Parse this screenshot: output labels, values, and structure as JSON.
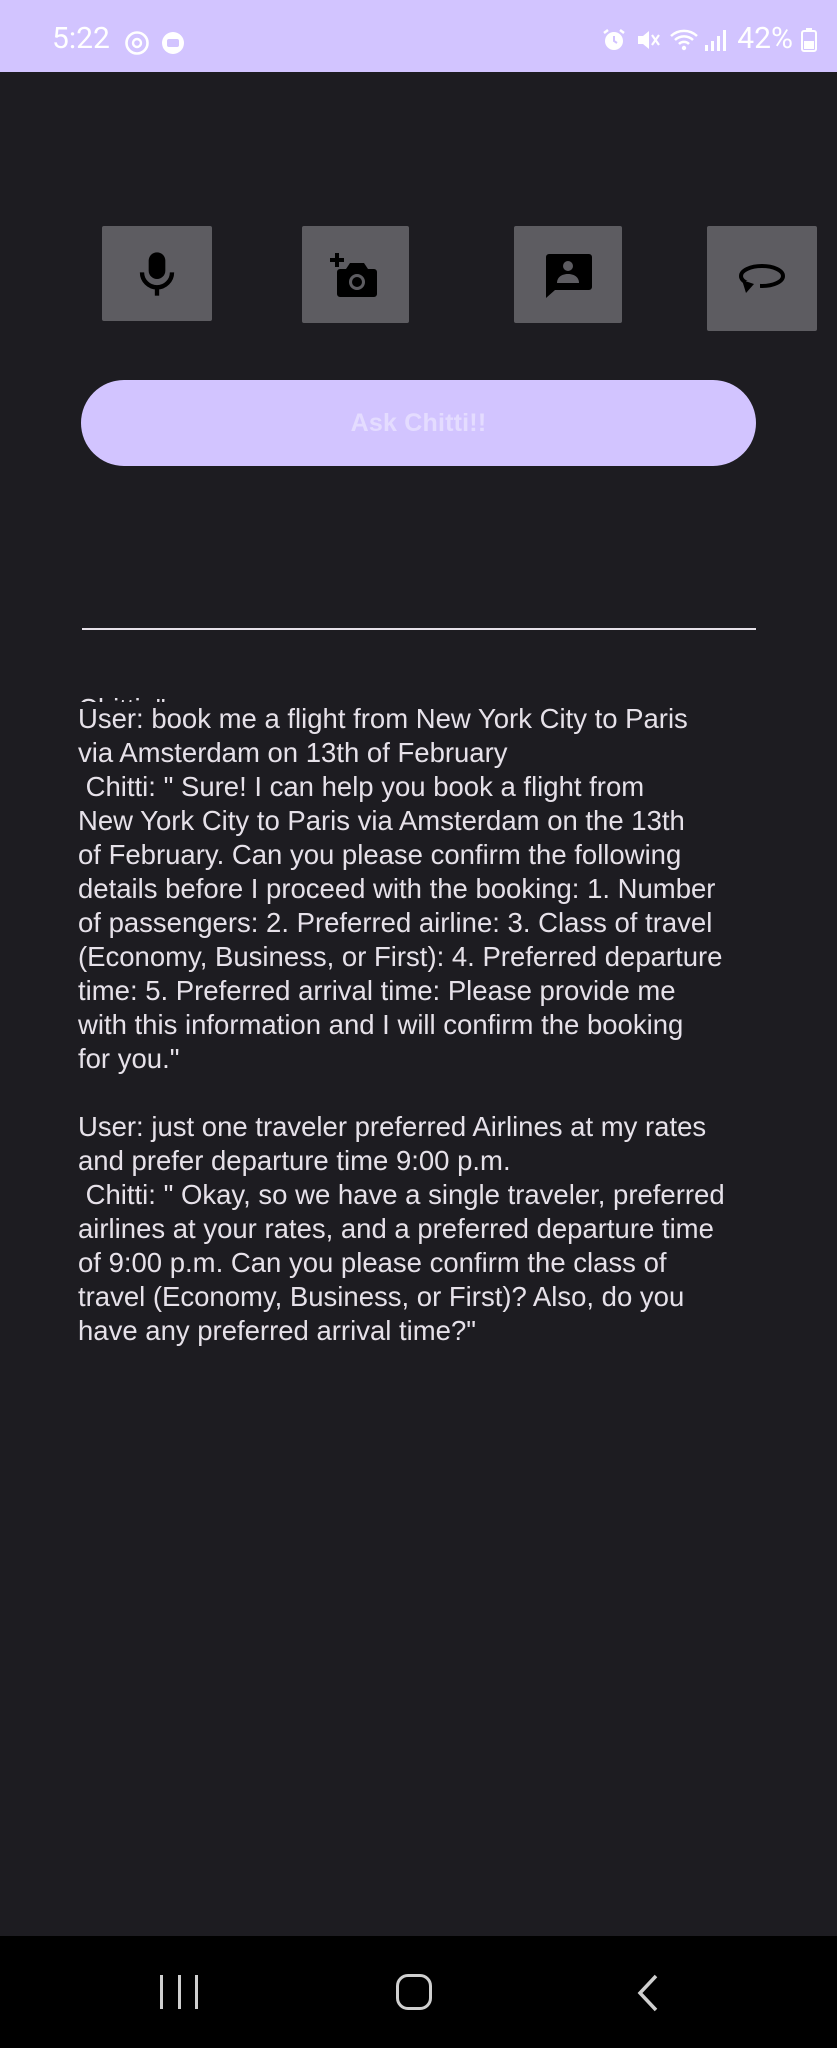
{
  "status_bar": {
    "time": "5:22",
    "battery": "42%",
    "icons": [
      "sync-icon",
      "app-notification-icon",
      "alarm-icon",
      "mute-icon",
      "wifi-icon",
      "signal-icon",
      "battery-icon"
    ]
  },
  "toolbar": {
    "buttons": [
      {
        "name": "mic-button",
        "icon": "mic-icon"
      },
      {
        "name": "camera-button",
        "icon": "add-camera-icon"
      },
      {
        "name": "chat-button",
        "icon": "chat-profile-icon"
      },
      {
        "name": "reset-button",
        "icon": "rotate-icon"
      }
    ]
  },
  "ask": {
    "label": "Ask Chitti!!"
  },
  "input": {
    "value": "",
    "placeholder": ""
  },
  "chat": {
    "clipped_line": "Chitti: \" ... ",
    "messages": [
      "User: book me a flight from New York City to Paris\nvia Amsterdam on 13th of February\n Chitti: \" Sure! I can help you book a flight from\nNew York City to Paris via Amsterdam on the 13th\nof February. Can you please confirm the following\ndetails before I proceed with the booking: 1. Number\nof passengers: 2. Preferred airline: 3. Class of travel\n(Economy, Business, or First): 4. Preferred departure\ntime: 5. Preferred arrival time: Please provide me\nwith this information and I will confirm the booking\nfor you.\"",
      "User: just one traveler preferred Airlines at my rates\nand prefer departure time 9:00 p.m.\n Chitti: \" Okay, so we have a single traveler, preferred\nairlines at your rates, and a preferred departure time\nof 9:00 p.m. Can you please confirm the class of\ntravel (Economy, Business, or First)? Also, do you\nhave any preferred arrival time?\""
    ]
  },
  "colors": {
    "accent": "#d2c4ff",
    "background": "#1d1c21",
    "tool_button": "#5d5c61",
    "text": "#e6e1e9"
  }
}
